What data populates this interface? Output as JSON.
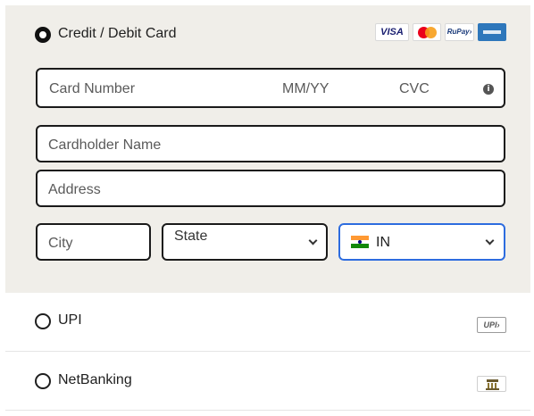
{
  "payment_options": {
    "card": {
      "label": "Credit / Debit Card",
      "selected": true,
      "brands": [
        "visa-logo",
        "mastercard-logo",
        "rupay-logo",
        "amex-logo"
      ],
      "visa_text": "VISA",
      "rupay_text": "RuPay›",
      "fields": {
        "card_number_placeholder": "Card Number",
        "expiry_placeholder": "MM/YY",
        "cvc_placeholder": "CVC",
        "cardholder_placeholder": "Cardholder Name",
        "address_placeholder": "Address",
        "city_placeholder": "City",
        "state_value": "State",
        "country_value": "IN",
        "country_flag": "india-flag-icon"
      }
    },
    "upi": {
      "label": "UPI",
      "selected": false,
      "logo_text": "UPI›"
    },
    "netbanking": {
      "label": "NetBanking",
      "selected": false
    }
  },
  "colors": {
    "selected_section_bg": "#f0eee9",
    "focused_border": "#2d6cdf",
    "field_border": "#1a1a1a"
  }
}
